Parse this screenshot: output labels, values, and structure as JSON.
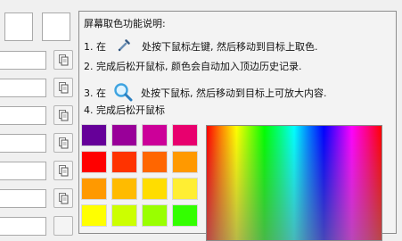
{
  "instructions": {
    "title": "屏幕取色功能说明:",
    "step1_prefix": "1. 在",
    "step1_suffix": "处按下鼠标左键, 然后移动到目标上取色.",
    "step2": "2. 完成后松开鼠标, 颜色会自动加入顶边历史记录.",
    "step3_prefix": "3. 在",
    "step3_suffix": "处按下鼠标, 然后移动到目标上可放大内容.",
    "step4": "4. 完成后松开鼠标"
  },
  "icons": {
    "eyedropper": "eyedropper-icon",
    "magnifier": "magnifier-icon",
    "copy": "copy-icon"
  },
  "palette": [
    [
      "#660099",
      "#990099",
      "#cc0099",
      "#e8006e"
    ],
    [
      "#ff0000",
      "#ff3300",
      "#ff6600",
      "#ff9900"
    ],
    [
      "#ff9900",
      "#ffbb00",
      "#ffdd00",
      "#ffee33"
    ],
    [
      "#ffff00",
      "#ccff00",
      "#99ff00",
      "#33ff00"
    ]
  ]
}
